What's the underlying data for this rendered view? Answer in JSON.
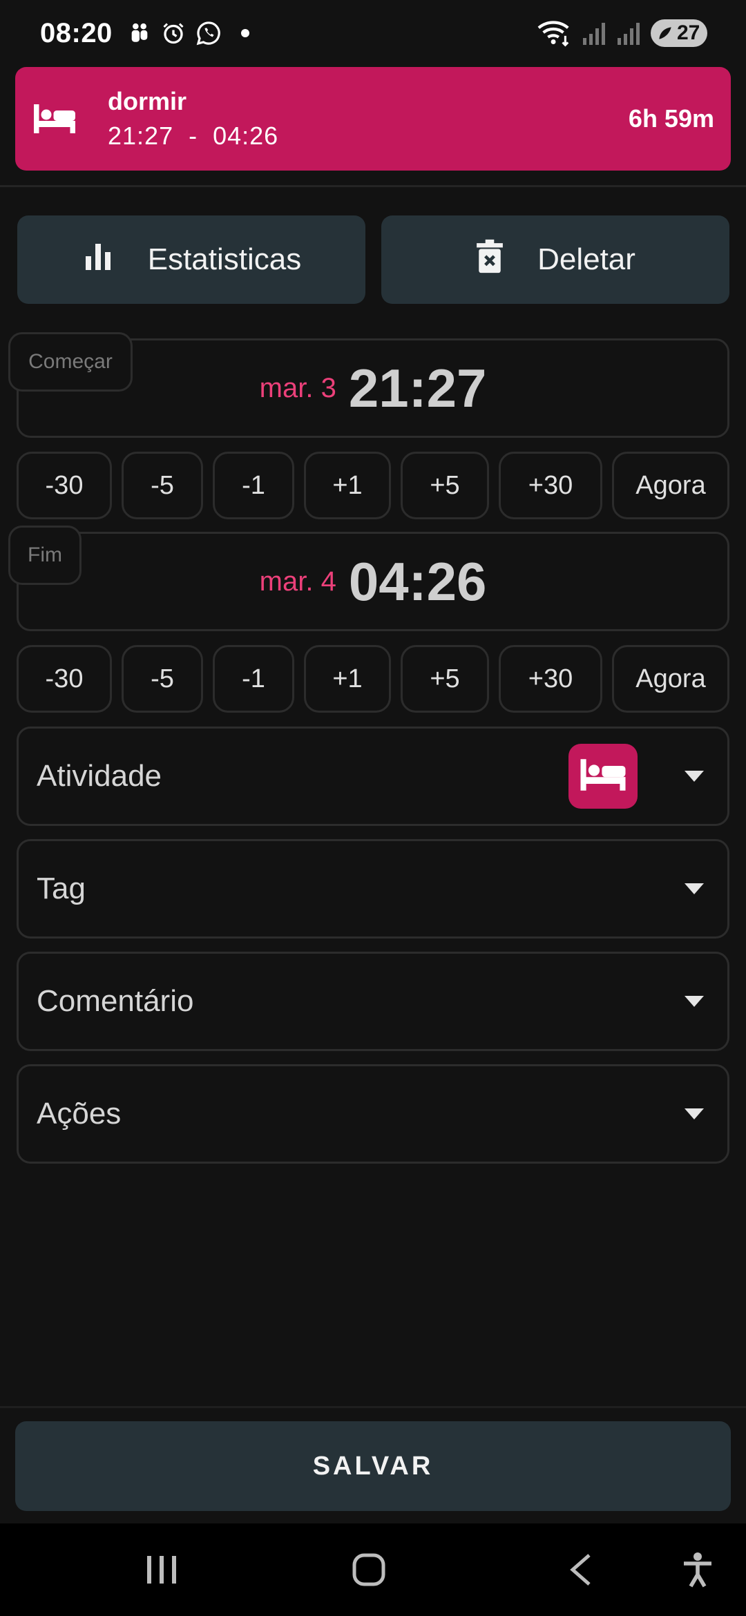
{
  "status_bar": {
    "time": "08:20",
    "battery": "27",
    "notification_icons": [
      "family-icon",
      "alarm-clock-icon",
      "whatsapp-icon",
      "dot-icon"
    ],
    "system_icons": [
      "wifi-icon",
      "signal-icon",
      "signal-icon",
      "battery-icon"
    ]
  },
  "banner": {
    "title": "dormir",
    "range": "21:27  -  04:26",
    "duration": "6h 59m",
    "icon": "bed-icon",
    "color": "#c2185b"
  },
  "actions": {
    "stats_label": "Estatisticas",
    "delete_label": "Deletar",
    "stats_icon": "bar-chart-icon",
    "delete_icon": "delete-icon"
  },
  "start": {
    "label": "Começar",
    "date": "mar. 3",
    "time": "21:27"
  },
  "end": {
    "label": "Fim",
    "date": "mar. 4",
    "time": "04:26"
  },
  "adjust_buttons": [
    "-30",
    "-5",
    "-1",
    "+1",
    "+5",
    "+30",
    "Agora"
  ],
  "fields": {
    "activity": "Atividade",
    "tag": "Tag",
    "comment": "Comentário",
    "actions": "Ações"
  },
  "save_label": "SALVAR",
  "colors": {
    "accent": "#c2185b",
    "date_accent": "#ec407a",
    "button_bg": "#263238",
    "background": "#121212"
  }
}
